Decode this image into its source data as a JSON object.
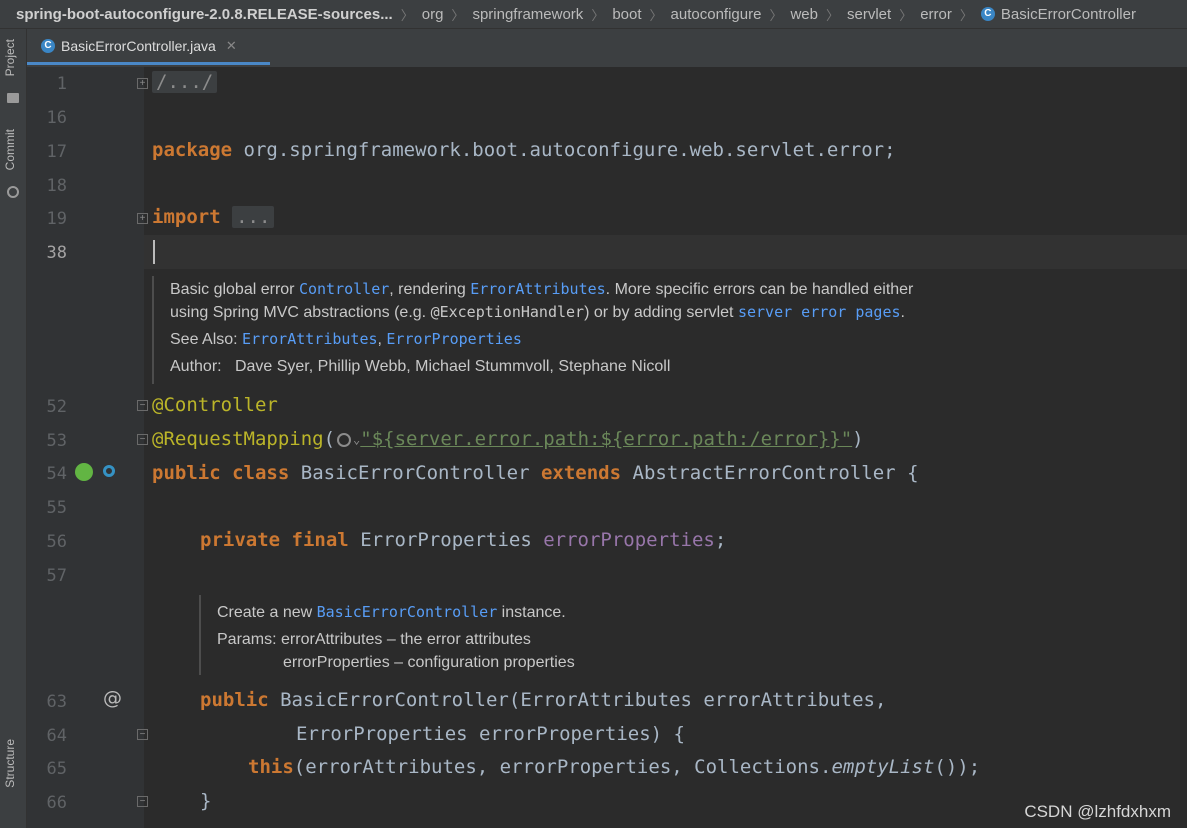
{
  "breadcrumb": [
    "spring-boot-autoconfigure-2.0.8.RELEASE-sources...",
    "org",
    "springframework",
    "boot",
    "autoconfigure",
    "web",
    "servlet",
    "error",
    "BasicErrorController"
  ],
  "side_tabs": {
    "project": "Project",
    "commit": "Commit",
    "structure": "Structure"
  },
  "editor_tab": {
    "file_name": "BasicErrorController.java"
  },
  "line_numbers": {
    "l1": "1",
    "l16": "16",
    "l17": "17",
    "l18": "18",
    "l19": "19",
    "l38": "38",
    "l52": "52",
    "l53": "53",
    "l54": "54",
    "l55": "55",
    "l56": "56",
    "l57": "57",
    "l63": "63",
    "l64": "64",
    "l65": "65",
    "l66": "66"
  },
  "code": {
    "fold_header": "/.../",
    "package_kw": "package",
    "package_name": "org.springframework.boot.autoconfigure.web.servlet.error",
    "semicolon": ";",
    "import_kw": "import",
    "import_fold": "...",
    "ann_controller": "@Controller",
    "ann_request": "@RequestMapping",
    "paren_open": "(",
    "path_string": "\"${server.error.path:${error.path:/error}}\"",
    "paren_close": ")",
    "public_kw": "public",
    "class_kw": "class",
    "class_name": "BasicErrorController",
    "extends_kw": "extends",
    "super_name": "AbstractErrorController",
    "brace_open": "{",
    "private_kw": "private",
    "final_kw": "final",
    "field_type": "ErrorProperties",
    "field_name": "errorProperties",
    "ctor_name": "BasicErrorController",
    "param1_type": "ErrorAttributes",
    "param1_name": "errorAttributes,",
    "param2_type": "ErrorProperties",
    "param2_name": "errorProperties) {",
    "this_kw": "this",
    "this_args": "(errorAttributes, errorProperties, ",
    "collections": "Collections",
    "dot": ".",
    "empty_list": "emptyList",
    "call_end": "());",
    "brace_close": "}",
    "gutter_at": "@"
  },
  "doc_class": {
    "l1_a": "Basic global error ",
    "l1_link1": "Controller",
    "l1_b": ", rendering ",
    "l1_link2": "ErrorAttributes",
    "l1_c": ". More specific errors can be handled either",
    "l2_a": "using Spring MVC abstractions (e.g. ",
    "l2_code": "@ExceptionHandler",
    "l2_b": ") or by adding servlet ",
    "l2_link": "server error pages",
    "l2_c": ".",
    "see_label": "See Also: ",
    "see_link1": "ErrorAttributes",
    "see_comma": ", ",
    "see_link2": "ErrorProperties",
    "author_label": "Author:",
    "authors": "Dave Syer, Phillip Webb, Michael Stummvoll, Stephane Nicoll"
  },
  "doc_ctor": {
    "l1_a": "Create a new ",
    "l1_link": "BasicErrorController",
    "l1_b": " instance.",
    "params_label": "Params:",
    "param1": "errorAttributes – the error attributes",
    "param2": "errorProperties – configuration properties"
  },
  "watermark": "CSDN @lzhfdxhxm",
  "colors": {
    "keyword": "#cc7832",
    "annotation": "#bbb529",
    "string": "#6a8759",
    "field": "#9876aa",
    "link": "#589df6",
    "background": "#2b2b2b"
  }
}
